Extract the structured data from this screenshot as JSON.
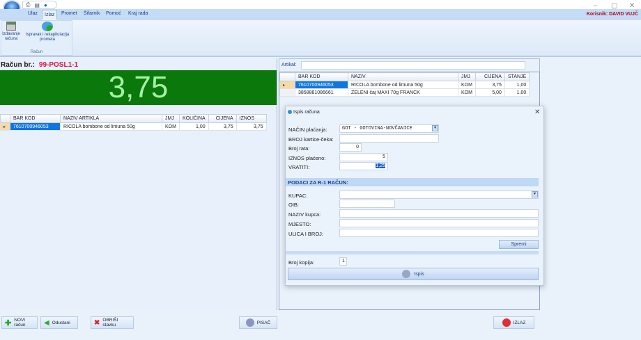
{
  "window": {
    "minimize": "–",
    "maximize": "▢",
    "close": "✕"
  },
  "ribbon": {
    "tabs": [
      "Ulaz",
      "Izlaz",
      "Promet",
      "Šifarnik",
      "Pomoć",
      "Kraj rada"
    ],
    "active_tab": "Izlaz",
    "user": "Korisnik: DAVID VUJČ",
    "buttons": [
      {
        "label": "Izdavanje računa",
        "icon": "cash-register-icon"
      },
      {
        "label": "Ispravak i rekapitulacija prometa",
        "icon": "correction-icon"
      }
    ],
    "group_label": "Račun"
  },
  "racun": {
    "label": "Račun br.:",
    "number": "99-POSL1-1",
    "total": "3,75"
  },
  "items_grid": {
    "columns": [
      "BAR KOD",
      "NAZIV ARTIKLA",
      "JMJ",
      "KOLIČINA",
      "CIJENA",
      "IZNOS"
    ],
    "rows": [
      [
        "7610700946053",
        "RICOLA bombone od limuna 50g",
        "KOM",
        "1,00",
        "3,75",
        "3,75"
      ]
    ]
  },
  "artikal": {
    "label": "Artikal:",
    "value": ""
  },
  "articles_grid": {
    "columns": [
      "BAR KOD",
      "NAZIV",
      "JMJ",
      "CIJENA",
      "STANJE"
    ],
    "rows": [
      [
        "7610700946053",
        "RICOLA bombone od limuna 50g",
        "KOM",
        "3,75",
        "1,00"
      ],
      [
        "3858881086661",
        "ZELENI čaj MAXI 70g FRANCK",
        "KOM",
        "5,00",
        "1,00"
      ]
    ]
  },
  "dialog": {
    "title": "Ispis računa",
    "nacin_label": "NAČIN plaćanja:",
    "nacin_value": "GOT - GOTOVINA-NOVČANICE",
    "kartica_label": "BROJ kartice-čeka:",
    "kartica_value": "",
    "rata_label": "Broj rata:",
    "rata_value": "0",
    "iznos_label": "IZNOS plaćeno:",
    "iznos_value": "5",
    "vratiti_label": "VRATITI:",
    "vratiti_value": "1,25",
    "section": "PODACI ZA R-1 RAČUN:",
    "kupac_label": "KUPAC:",
    "oib_label": "OIB:",
    "naziv_label": "NAZIV kupca:",
    "mjesto_label": "MJESTO:",
    "ulica_label": "ULICA I BROJ:",
    "spremi": "Spremi",
    "kopija_label": "Broj kopija:",
    "kopija_value": "1",
    "ispis": "Ispis"
  },
  "bottom": {
    "novi": "NOVI račun",
    "odustani": "Odustani",
    "obrisi": "OBRIŠI stavku",
    "pisac": "PISAČ",
    "izlaz": "IZLAZ"
  }
}
